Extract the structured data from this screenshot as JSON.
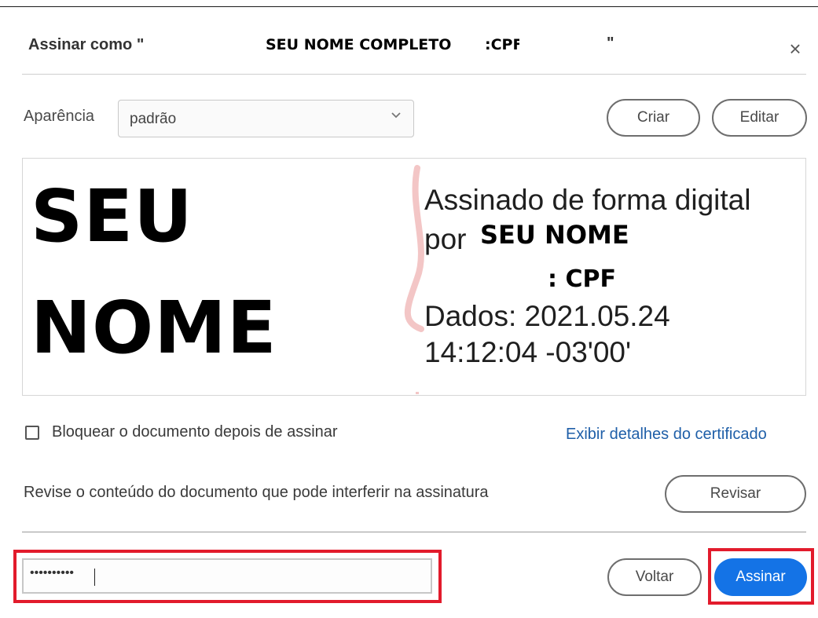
{
  "dialog": {
    "title_prefix": "Assinar como \"",
    "title_name": "SEU NOME COMPLETO",
    "title_cpf": ":CPF",
    "title_suffix": "\"",
    "close_label": "×"
  },
  "appearance": {
    "label": "Aparência",
    "selected": "padrão",
    "create_label": "Criar",
    "edit_label": "Editar"
  },
  "preview": {
    "name_line1": "SEU",
    "name_line2": "NOME",
    "info_line1": "Assinado de forma digital",
    "info_line2_prefix": "por",
    "info_name": "SEU NOME",
    "info_cpf": ": CPF",
    "info_date": "Dados: 2021.05.24",
    "info_time": "14:12:04 -03'00'"
  },
  "options": {
    "lock_label": "Bloquear o documento depois de assinar",
    "lock_checked": false,
    "details_link": "Exibir detalhes do certificado"
  },
  "review": {
    "text": "Revise o conteúdo do documento que pode interferir na assinatura",
    "button_label": "Revisar"
  },
  "footer": {
    "password_value": "••••••••••",
    "back_label": "Voltar",
    "sign_label": "Assinar"
  },
  "colors": {
    "primary": "#1473e6",
    "highlight": "#e21b2c",
    "link": "#1f5fa8"
  }
}
